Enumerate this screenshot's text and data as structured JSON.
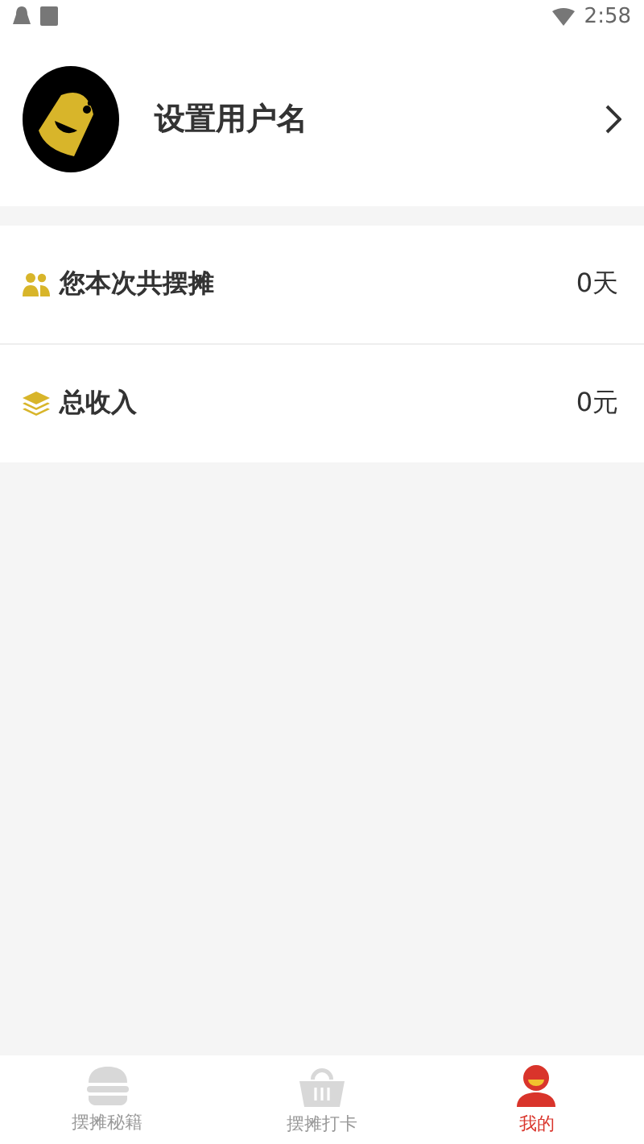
{
  "status_bar": {
    "time": "2:58"
  },
  "profile": {
    "username": "设置用户名"
  },
  "stats": [
    {
      "kind": "people",
      "label": "您本次共摆摊",
      "value": "0天"
    },
    {
      "kind": "layers",
      "label": "总收入",
      "value": "0元"
    }
  ],
  "tab_bar": [
    {
      "kind": "burger",
      "label": "摆摊秘籍",
      "selected": false
    },
    {
      "kind": "basket",
      "label": "摆摊打卡",
      "selected": false
    },
    {
      "kind": "person",
      "label": "我的",
      "selected": true
    }
  ]
}
